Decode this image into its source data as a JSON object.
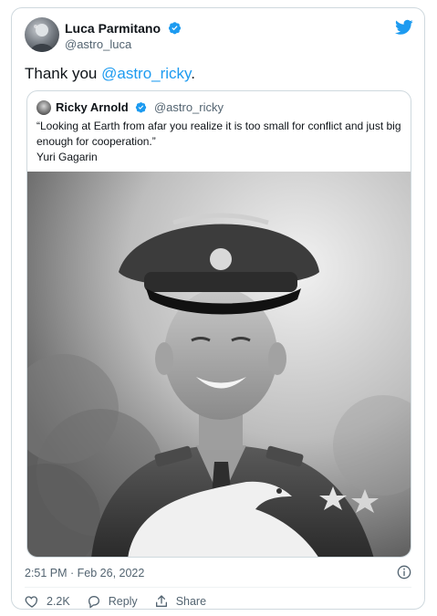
{
  "author": {
    "name": "Luca Parmitano",
    "handle": "@astro_luca"
  },
  "tweet": {
    "text_prefix": "Thank you ",
    "mention": "@astro_ricky",
    "text_suffix": "."
  },
  "quoted": {
    "name": "Ricky Arnold",
    "handle": "@astro_ricky",
    "text_line1": "“Looking at Earth from afar you realize it is too small for conflict and just big enough for cooperation.”",
    "text_line2": "Yuri Gagarin"
  },
  "meta": {
    "timestamp": "2:51 PM · Feb 26, 2022"
  },
  "actions": {
    "likes": "2.2K",
    "reply": "Reply",
    "share": "Share"
  },
  "colors": {
    "accent": "#1d9bf0",
    "like": "#536471",
    "text": "#0f1419",
    "secondary": "#536471"
  },
  "icons": [
    "twitter-bird-icon",
    "verified-badge-icon",
    "info-icon",
    "heart-icon",
    "reply-icon",
    "share-icon"
  ]
}
